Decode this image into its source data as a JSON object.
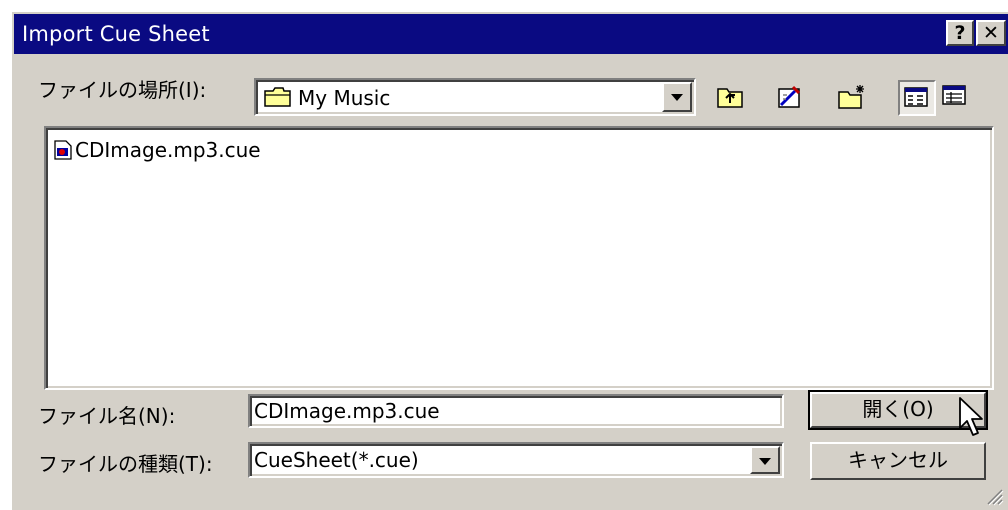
{
  "window": {
    "title": "Import Cue Sheet",
    "help_label": "?",
    "close_label": "✕"
  },
  "location": {
    "label": "ファイルの場所(I):",
    "value": "My Music"
  },
  "toolbar": {
    "icons": [
      "up-one-level-icon",
      "go-to-last-folder-icon",
      "create-new-folder-icon",
      "list-view-icon",
      "details-view-icon"
    ]
  },
  "file_list": {
    "items": [
      {
        "name": "CDImage.mp3.cue",
        "icon": "cue-file-icon"
      }
    ]
  },
  "filename": {
    "label": "ファイル名(N):",
    "value": "CDImage.mp3.cue"
  },
  "filetype": {
    "label": "ファイルの種類(T):",
    "value": "CueSheet(*.cue)"
  },
  "buttons": {
    "open_label": "開く(O)",
    "cancel_label": "キャンセル"
  },
  "colors": {
    "titlebar": "#0a0a82",
    "face": "#d4d0c8",
    "window": "#ffffff"
  }
}
